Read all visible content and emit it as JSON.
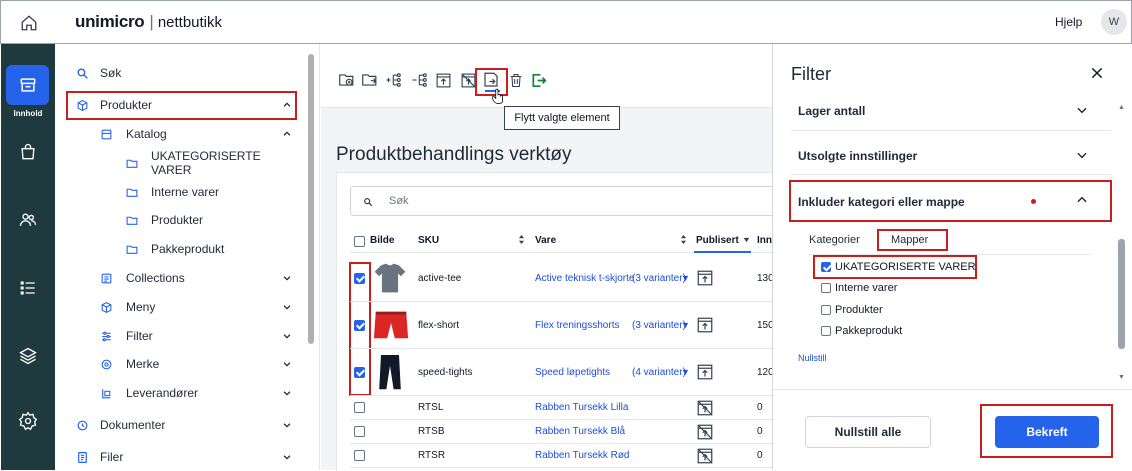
{
  "header": {
    "brand": "unimicro",
    "product": "nettbutikk",
    "help": "Hjelp",
    "avatar": "W"
  },
  "rail": {
    "active_label": "Innhold",
    "items": [
      "store-icon",
      "bag-icon",
      "users-icon",
      "list-icon",
      "layers-icon",
      "settings-icon"
    ]
  },
  "sidebar": {
    "items": [
      {
        "label": "Søk",
        "icon": "search-icon"
      },
      {
        "label": "Produkter",
        "icon": "box-icon"
      },
      {
        "label": "Katalog",
        "icon": "catalog-icon"
      },
      {
        "label": "UKATEGORISERTE VARER",
        "icon": "folder-icon"
      },
      {
        "label": "Interne varer",
        "icon": "folder-icon"
      },
      {
        "label": "Produkter",
        "icon": "folder-icon"
      },
      {
        "label": "Pakkeprodukt",
        "icon": "folder-icon"
      },
      {
        "label": "Collections",
        "icon": "collections-icon"
      },
      {
        "label": "Meny",
        "icon": "cube-icon"
      },
      {
        "label": "Filter",
        "icon": "sliders-icon"
      },
      {
        "label": "Merke",
        "icon": "badge-icon"
      },
      {
        "label": "Leverandører",
        "icon": "supplier-icon"
      },
      {
        "label": "Dokumenter",
        "icon": "document-icon"
      },
      {
        "label": "Filer",
        "icon": "files-icon"
      }
    ]
  },
  "main": {
    "tooltip": "Flytt valgte element",
    "title": "Produktbehandlings verktøy",
    "search_placeholder": "Søk",
    "columns": {
      "image": "Bilde",
      "sku": "SKU",
      "vare": "Vare",
      "publisert": "Publisert",
      "inn": "Inn"
    },
    "rows": [
      {
        "checked": true,
        "sku": "active-tee",
        "vare": "Active teknisk t-skjorte",
        "variants": "(3 varianter)",
        "inn": "130",
        "image": "tshirt"
      },
      {
        "checked": true,
        "sku": "flex-short",
        "vare": "Flex treningsshorts",
        "variants": "(3 varianter)",
        "inn": "150",
        "image": "shorts"
      },
      {
        "checked": true,
        "sku": "speed-tights",
        "vare": "Speed løpetights",
        "variants": "(4 varianter)",
        "inn": "120",
        "image": "tights"
      },
      {
        "checked": false,
        "sku": "RTSL",
        "vare": "Rabben Tursekk Lilla",
        "variants": "",
        "inn": "0"
      },
      {
        "checked": false,
        "sku": "RTSB",
        "vare": "Rabben Tursekk Blå",
        "variants": "",
        "inn": "0"
      },
      {
        "checked": false,
        "sku": "RTSR",
        "vare": "Rabben Tursekk Rød",
        "variants": "",
        "inn": "0"
      }
    ]
  },
  "filter": {
    "title": "Filter",
    "sections": [
      {
        "label": "Lager antall"
      },
      {
        "label": "Utsolgte innstillinger"
      },
      {
        "label": "Inkluder kategori eller mappe"
      }
    ],
    "tabs": [
      "Kategorier",
      "Mapper"
    ],
    "options": [
      {
        "label": "UKATEGORISERTE VARER",
        "checked": true
      },
      {
        "label": "Interne varer",
        "checked": false
      },
      {
        "label": "Produkter",
        "checked": false
      },
      {
        "label": "Pakkeprodukt",
        "checked": false
      }
    ],
    "reset_link": "Nullstill",
    "reset_all": "Nullstill alle",
    "confirm": "Bekreft"
  }
}
